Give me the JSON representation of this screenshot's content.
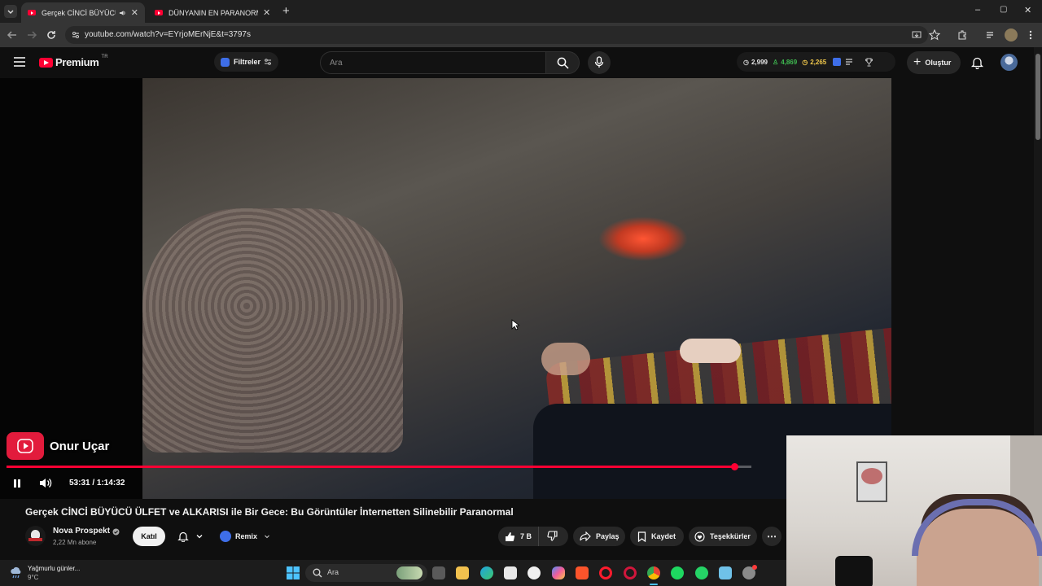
{
  "browser": {
    "tabs": [
      {
        "title": "Gerçek CİNCİ BÜYÜCÜ ÜLFET",
        "active": true,
        "audio": true
      },
      {
        "title": "DÜNYANIN EN PARANORMAL",
        "active": false,
        "audio": false
      }
    ],
    "new_tab": "+",
    "url": "youtube.com/watch?v=EYrjoMErNjE&t=3797s",
    "window_controls": {
      "minimize": "–",
      "restore": "▢",
      "close": "✕"
    }
  },
  "masthead": {
    "logo_text": "Premium",
    "region": "TR",
    "filters_label": "Filtreler",
    "search_placeholder": "Ara",
    "stats": [
      {
        "value": "2,999",
        "color": "#cfcfcf"
      },
      {
        "value": "4,869",
        "color": "#3fb950"
      },
      {
        "value": "2,265",
        "color": "#f2c94c"
      }
    ],
    "create_label": "Oluştur"
  },
  "player": {
    "watermark": "Onur Uçar",
    "current_time": "53:31",
    "duration": "1:14:32",
    "time_display": "53:31 / 1:14:32",
    "progress_fraction": 0.978,
    "buffered_fraction": 1.0
  },
  "video": {
    "title": "Gerçek CİNCİ BÜYÜCÜ ÜLFET ve ALKARISI ile Bir Gece: Bu Görüntüler İnternetten Silinebilir Paranormal",
    "channel": "Nova Prospekt",
    "subscribers": "2,22 Mn abone",
    "join_label": "Katıl",
    "remix_label": "Remix",
    "likes": "7 B",
    "share_label": "Paylaş",
    "save_label": "Kaydet",
    "thanks_label": "Teşekkürler",
    "more": "⋯"
  },
  "taskbar": {
    "weather_text": "Yağmurlu günler...",
    "temperature": "9°C",
    "search_label": "Ara"
  },
  "colors": {
    "accent": "#ff0033",
    "background": "#0f0f0f",
    "pill": "#272727"
  }
}
